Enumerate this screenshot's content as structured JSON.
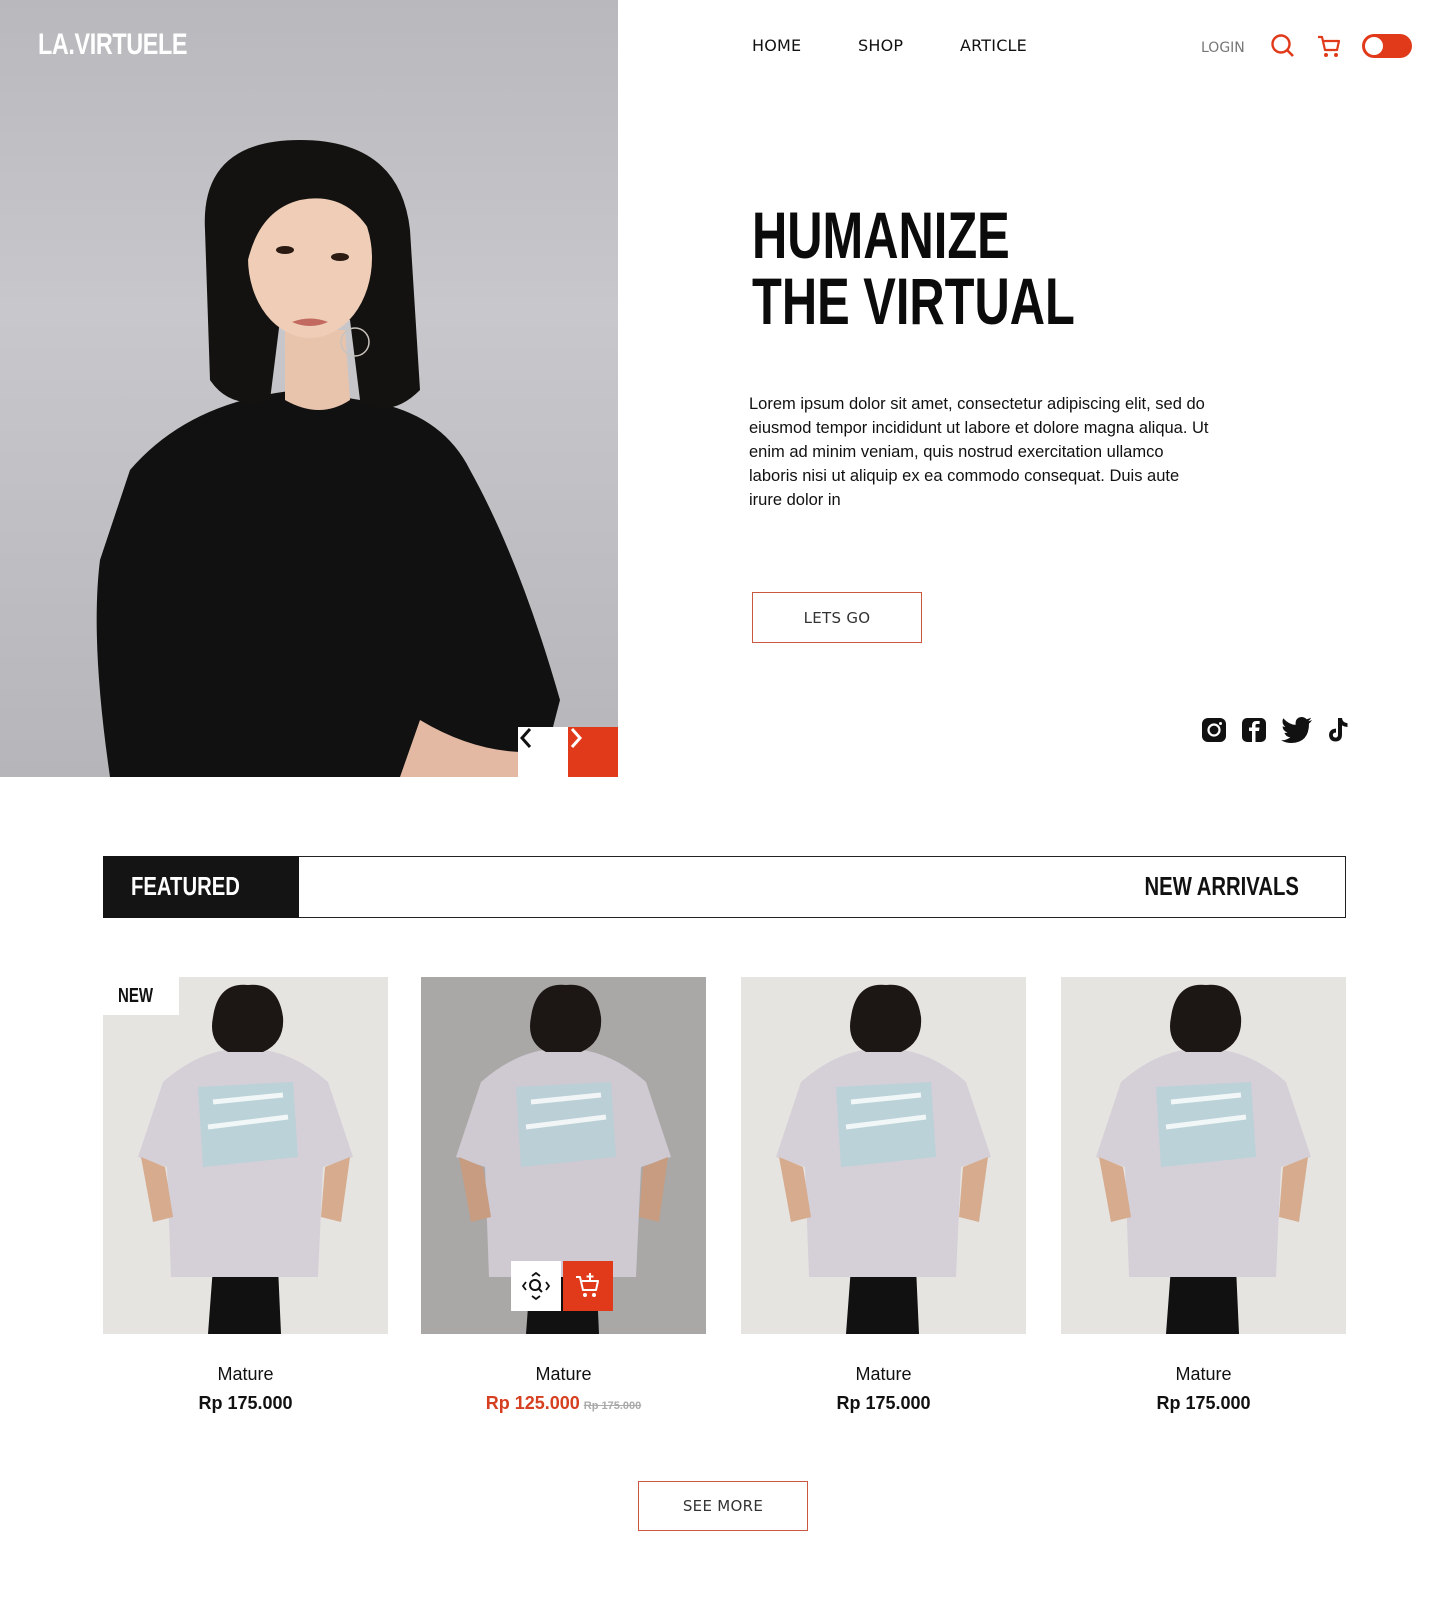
{
  "brand": "LA.VIRTUELE",
  "nav": {
    "home": "HOME",
    "shop": "SHOP",
    "article": "ARTICLE",
    "login": "LOGIN"
  },
  "icons": {
    "search": "search-icon",
    "cart": "cart-icon",
    "toggle": "theme-toggle",
    "prev": "chevron-left-icon",
    "next": "chevron-right-icon",
    "socials": [
      "instagram-icon",
      "facebook-icon",
      "twitter-icon",
      "tiktok-icon"
    ]
  },
  "colors": {
    "accent": "#e03a1a",
    "dark": "#141414",
    "outline": "#c9583e"
  },
  "hero": {
    "headline_line1": "HUMANIZE",
    "headline_line2": "THE VIRTUAL",
    "body": "Lorem ipsum dolor sit amet, consectetur adipiscing elit, sed do eiusmod tempor incididunt ut labore et dolore magna aliqua. Ut enim ad minim veniam, quis nostrud exercitation ullamco laboris nisi ut aliquip ex ea commodo consequat. Duis aute irure dolor in",
    "cta": "LETS GO"
  },
  "tabs": {
    "featured": "FEATURED",
    "new_arrivals": "NEW ARRIVALS"
  },
  "products": [
    {
      "name": "Mature",
      "price": "Rp 175.000",
      "badge": "NEW"
    },
    {
      "name": "Mature",
      "price": "Rp 125.000",
      "old_price": "Rp 175.000"
    },
    {
      "name": "Mature",
      "price": "Rp 175.000"
    },
    {
      "name": "Mature",
      "price": "Rp 175.000"
    }
  ],
  "see_more": "SEE MORE"
}
